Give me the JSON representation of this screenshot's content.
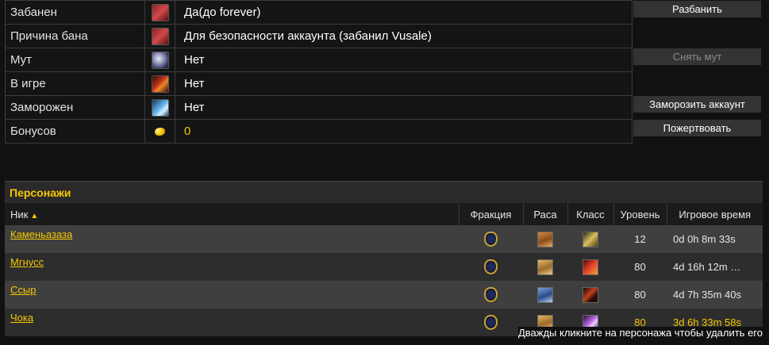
{
  "account": {
    "rows": [
      {
        "label": "Забанен",
        "icon": "ban-hand-icon",
        "value": "Да(до forever)"
      },
      {
        "label": "Причина бана",
        "icon": "ban-hand-icon",
        "value": "Для безопасности аккаунта (забанил Vusale)"
      },
      {
        "label": "Мут",
        "icon": "mute-icon",
        "value": "Нет"
      },
      {
        "label": "В игре",
        "icon": "online-icon",
        "value": "Нет"
      },
      {
        "label": "Заморожен",
        "icon": "frost-icon",
        "value": "Нет"
      },
      {
        "label": "Бонусов",
        "icon": "gold-coin-icon",
        "value": "0"
      }
    ],
    "buttons": {
      "unban": "Разбанить",
      "unmute": "Снять мут",
      "freeze": "Заморозить аккаунт",
      "donate": "Пожертвовать"
    },
    "unmute_disabled": true
  },
  "characters": {
    "title": "Персонажи",
    "columns": {
      "nick": "Ник",
      "faction": "Фракция",
      "race": "Раса",
      "class": "Класс",
      "level": "Уровень",
      "played": "Игровое время"
    },
    "sort": {
      "column": "nick",
      "direction": "ascending"
    },
    "rows": [
      {
        "name": "Каменьазаза",
        "faction": "alliance",
        "race": "dwarf",
        "class": "warrior",
        "level": "12",
        "played": "0d 0h 8m 33s"
      },
      {
        "name": "Мгнусс",
        "faction": "alliance",
        "race": "human",
        "class": "paladin",
        "level": "80",
        "played": "4d 16h 12m …"
      },
      {
        "name": "Ссыр",
        "faction": "alliance",
        "race": "draenei",
        "class": "death-knight",
        "level": "80",
        "played": "4d 7h 35m 40s"
      },
      {
        "name": "Чока",
        "faction": "alliance",
        "race": "human",
        "class": "priest",
        "level": "80",
        "played": "3d 6h 33m 58s"
      }
    ],
    "footer_hint": "Дважды кликните на персонажа чтобы удалить его"
  },
  "colors": {
    "accent": "#f5c800",
    "background": "#111111",
    "row_light": "#3f3f3f",
    "row_dark": "#2d2d2d"
  }
}
